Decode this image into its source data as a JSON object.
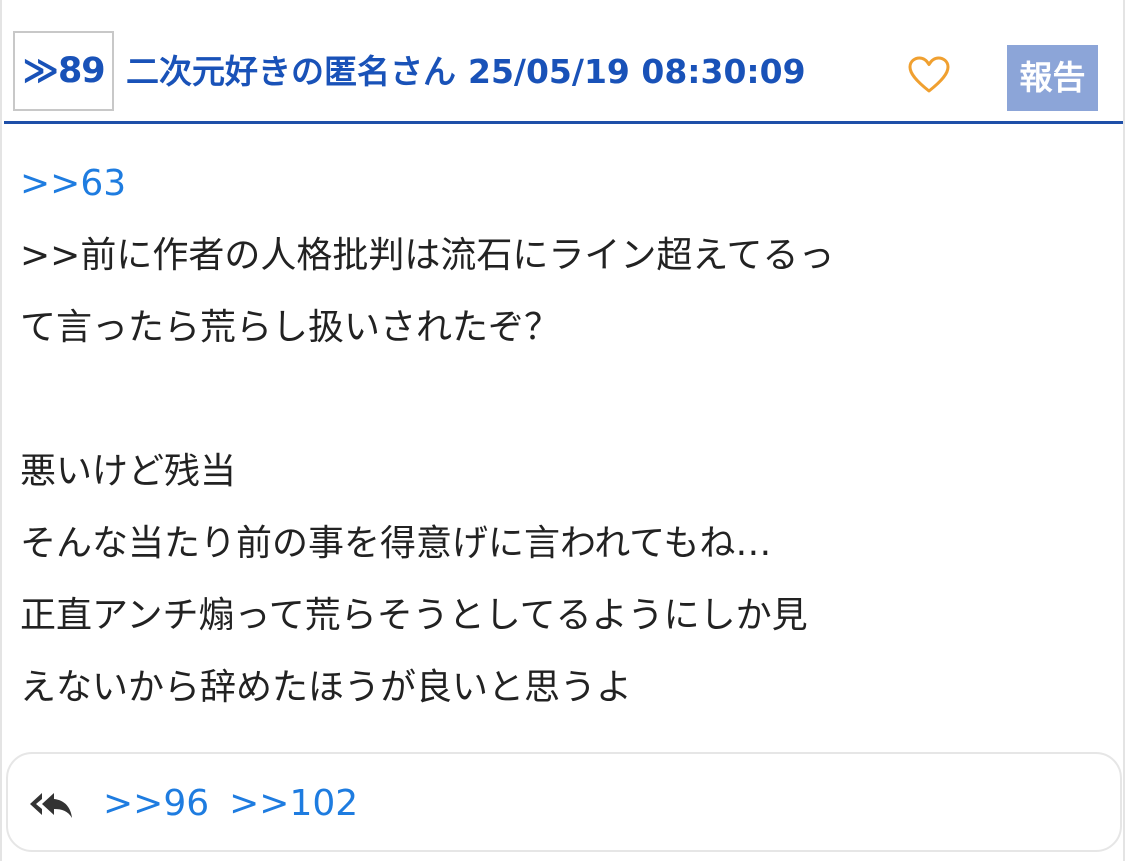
{
  "header": {
    "res_number": "≫89",
    "author": "二次元好きの匿名さん",
    "timestamp": "25/05/19 08:30:09",
    "like_icon": "heart-outline-icon",
    "report_label": "報告"
  },
  "body": {
    "anchor": ">>63",
    "lines": [
      ">>前に作者の人格批判は流石にライン超えてるっ",
      "て言ったら荒らし扱いされたぞ？",
      "",
      "悪いけど残当",
      "そんな当たり前の事を得意げに言われてもね…",
      "正直アンチ煽って荒らそうとしてるようにしか見",
      "えないから辞めたほうが良いと思うよ"
    ]
  },
  "footer": {
    "reply_icon": "reply-all-icon",
    "replies": [
      ">>96",
      ">>102"
    ]
  },
  "colors": {
    "accent_blue": "#1952b8",
    "link_blue": "#1e7ce0",
    "heart_orange": "#f0a030",
    "report_bg": "#8ca5d8"
  }
}
